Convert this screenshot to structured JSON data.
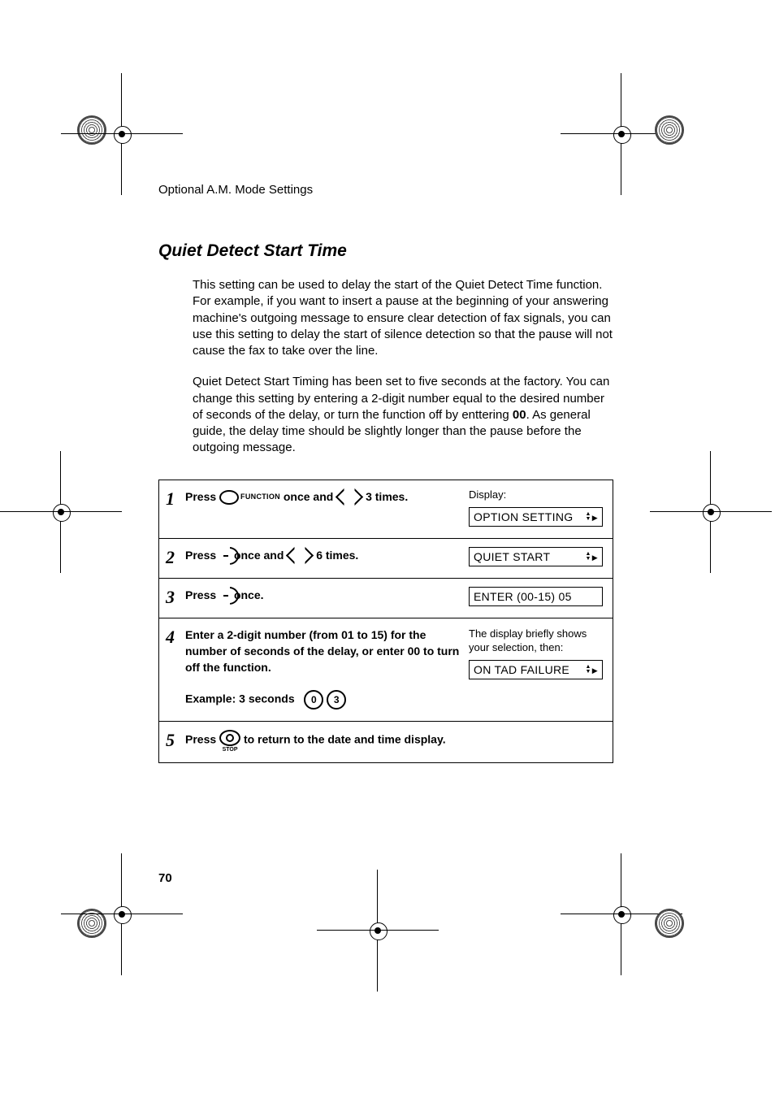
{
  "header": {
    "running": "Optional A.M. Mode Settings"
  },
  "section": {
    "title": "Quiet Detect Start Time",
    "para1": "This setting can be used to delay the start of the Quiet Detect Time function. For example, if you want to insert a pause at the beginning of your answering machine's outgoing message to ensure clear detection of fax signals, you can use this setting to delay the start of silence detection so that the pause will not cause the fax to take over the line.",
    "para2_pre": "Quiet Detect Start Timing has been set to five seconds at the factory. You can change this setting by entering a 2-digit number equal to the desired number of seconds of the delay, or turn the function off by enttering ",
    "para2_bold": "00",
    "para2_post": ". As general guide, the delay time should be slightly longer than the pause before the outgoing message."
  },
  "steps": {
    "s1": {
      "num": "1",
      "press": "Press",
      "function_label": "FUNCTION",
      "text_mid": " once and ",
      "nav_label": "1",
      "text_end": " 3 times.",
      "side_label": "Display:",
      "lcd": "OPTION SETTING"
    },
    "s2": {
      "num": "2",
      "press": "Press",
      "text_mid": " once and ",
      "nav_label": "1",
      "text_end": " 6 times.",
      "lcd": "QUIET START"
    },
    "s3": {
      "num": "3",
      "press": "Press",
      "text_mid": " once.",
      "lcd": "ENTER (00-15) 05"
    },
    "s4": {
      "num": "4",
      "line1": "Enter a 2-digit number (from 01 to 15) for the number of seconds of the delay, or enter 00 to turn off the function.",
      "example_label": "Example: 3 seconds",
      "key1": "0",
      "key2": "3",
      "note": "The display briefly shows your selection, then:",
      "lcd": "ON TAD FAILURE"
    },
    "s5": {
      "num": "5",
      "press": "Press",
      "stop_label": "STOP",
      "text_end": " to return to the date and time display."
    }
  },
  "page_number": "70"
}
